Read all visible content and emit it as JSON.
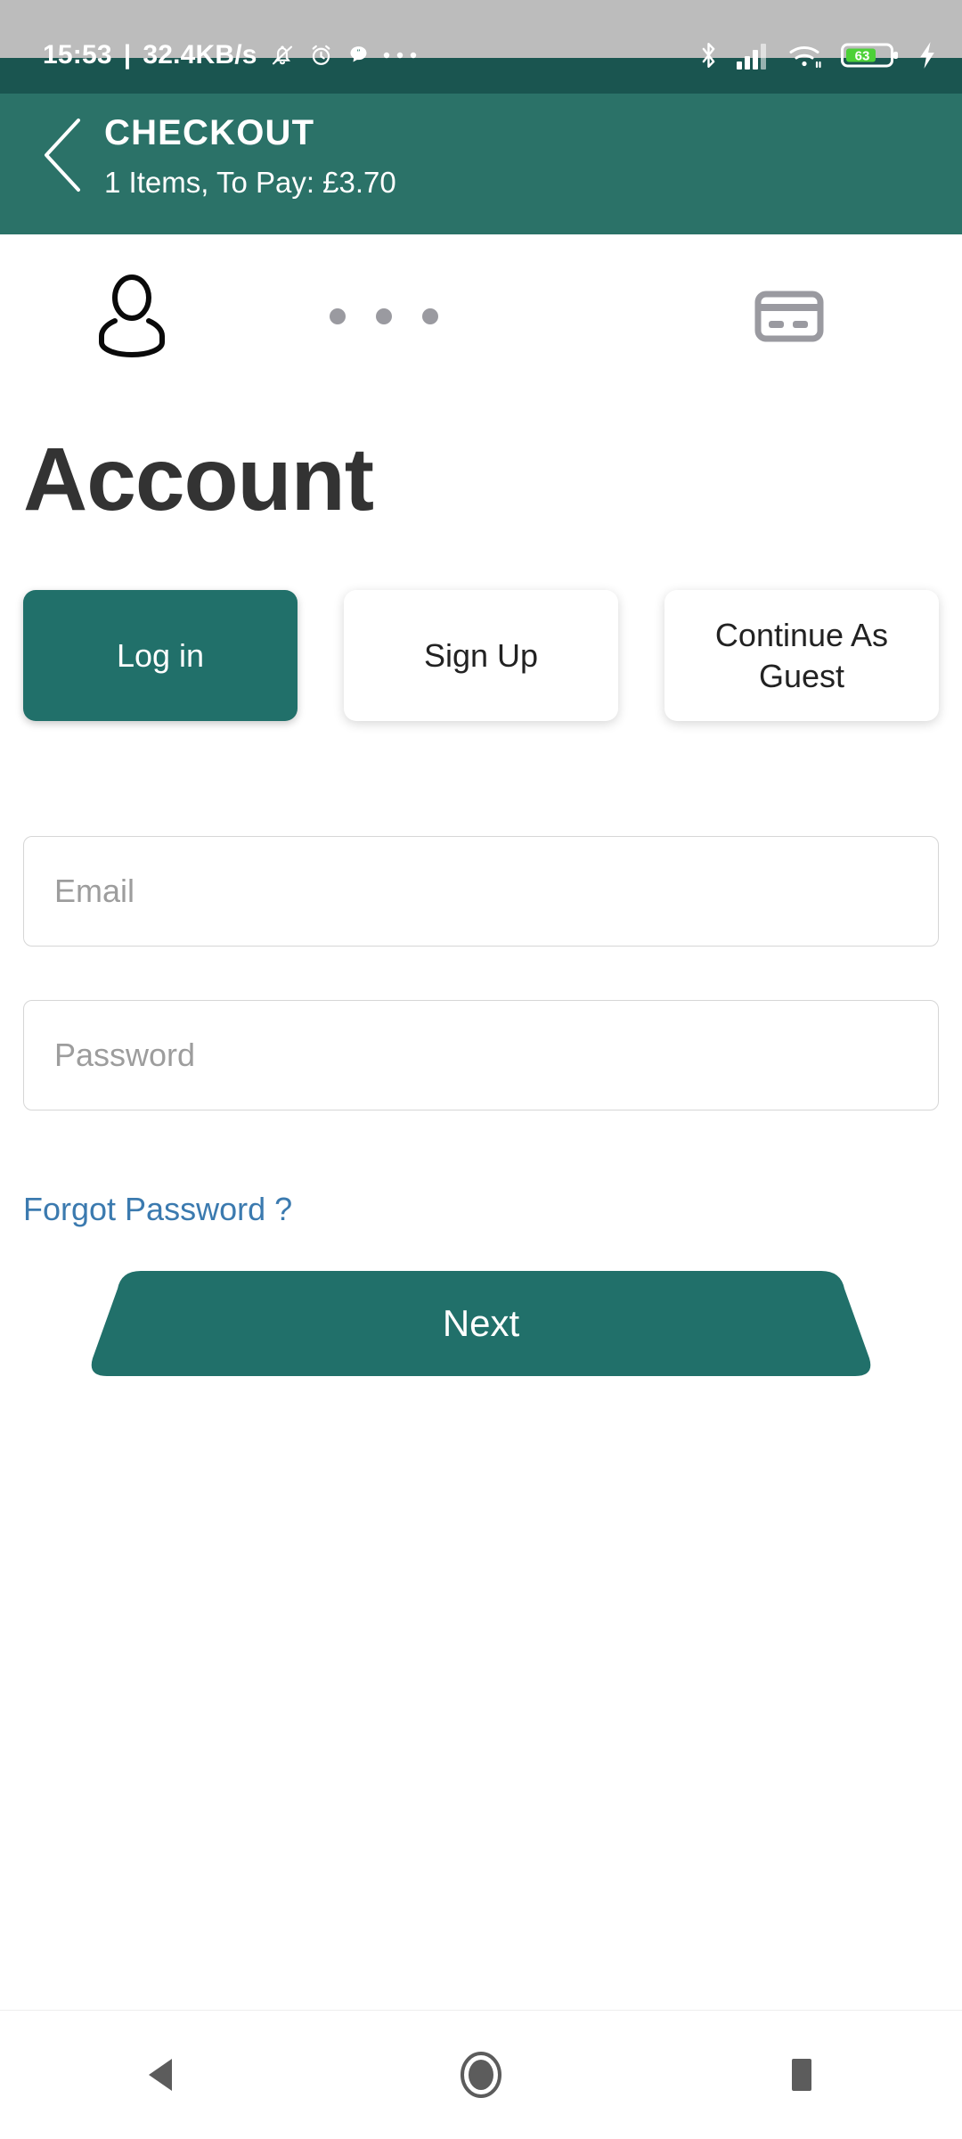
{
  "status_bar": {
    "time": "15:53",
    "separator": "|",
    "network_speed": "32.4KB/s",
    "left_icons": [
      "bell-muted-icon",
      "alarm-clock-icon",
      "quote-bubble-icon",
      "overflow-dots-icon"
    ],
    "right_icons": [
      "bluetooth-icon",
      "signal-bars-icon",
      "wifi-icon",
      "battery-icon",
      "charging-bolt-icon"
    ],
    "battery_level": "63",
    "colors": {
      "background": "#bcbcbc",
      "band": "#1a5550",
      "text": "#ffffff",
      "battery_fill": "#4cd137"
    }
  },
  "header": {
    "title": "CHECKOUT",
    "subtitle": "1 Items, To Pay: £3.70",
    "back_icon": "back-chevron-icon",
    "color": "#2b7268"
  },
  "stepper": {
    "steps": [
      {
        "icon": "person-icon",
        "state": "active"
      },
      {
        "icon": "credit-card-icon",
        "state": "inactive"
      }
    ],
    "separator_dots": 3,
    "active_color": "#000000",
    "inactive_color": "#9a9aa0"
  },
  "main": {
    "page_title": "Account",
    "tabs": [
      {
        "label": "Log in",
        "active": true
      },
      {
        "label": "Sign Up",
        "active": false
      },
      {
        "label": "Continue As Guest",
        "active": false
      }
    ],
    "fields": [
      {
        "name": "email",
        "placeholder": "Email",
        "value": ""
      },
      {
        "name": "password",
        "placeholder": "Password",
        "value": ""
      }
    ],
    "forgot_password_label": "Forgot Password ?",
    "forgot_password_color": "#3b7aaf",
    "next_button_label": "Next",
    "next_button_color": "#21706a",
    "active_tab_color": "#21706a"
  },
  "navigation_bar": {
    "buttons": [
      {
        "icon": "nav-back-triangle-icon",
        "name": "back"
      },
      {
        "icon": "nav-home-circle-icon",
        "name": "home"
      },
      {
        "icon": "nav-recents-square-icon",
        "name": "recents"
      }
    ],
    "color": "#5c5c5c"
  }
}
